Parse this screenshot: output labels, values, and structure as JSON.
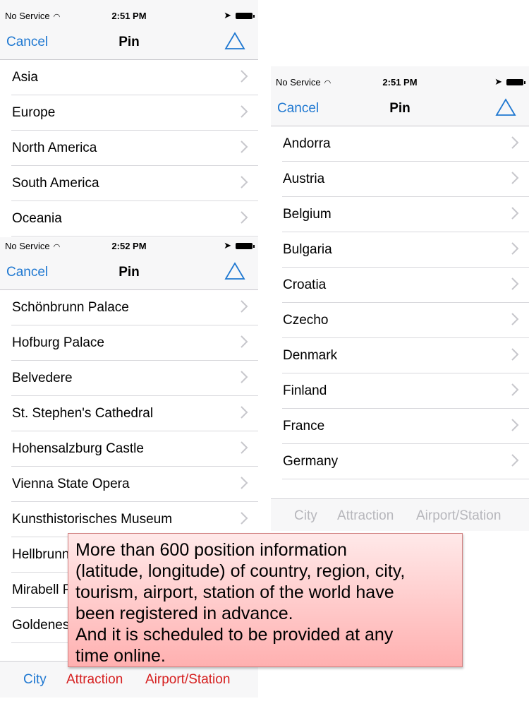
{
  "colors": {
    "accent": "#1f78d1",
    "red": "#d62020",
    "gray": "#b7b7bc"
  },
  "screens": {
    "top_left": {
      "status": {
        "carrier": "No Service",
        "time": "2:51 PM"
      },
      "nav": {
        "cancel": "Cancel",
        "title": "Pin",
        "share_icon": "share-triangle-icon"
      },
      "rows": [
        "Asia",
        "Europe",
        "North America",
        "South America",
        "Oceania"
      ]
    },
    "right": {
      "status": {
        "carrier": "No Service",
        "time": "2:51 PM"
      },
      "nav": {
        "cancel": "Cancel",
        "title": "Pin",
        "share_icon": "share-triangle-icon"
      },
      "rows": [
        "Andorra",
        "Austria",
        "Belgium",
        "Bulgaria",
        "Croatia",
        "Czecho",
        "Denmark",
        "Finland",
        "France",
        "Germany"
      ],
      "tabs": [
        "City",
        "Attraction",
        "Airport/Station"
      ]
    },
    "bottom_left": {
      "status": {
        "carrier": "No Service",
        "time": "2:52 PM"
      },
      "nav": {
        "cancel": "Cancel",
        "title": "Pin",
        "share_icon": "share-triangle-icon"
      },
      "rows": [
        "Schönbrunn Palace",
        "Hofburg Palace",
        "Belvedere",
        "St. Stephen's Cathedral",
        "Hohensalzburg Castle",
        "Vienna State Opera",
        "Kunsthistorisches Museum",
        "Hellbrunn",
        "Mirabell P",
        "Goldenes"
      ],
      "tabs": [
        "City",
        "Attraction",
        "Airport/Station"
      ]
    }
  },
  "callout": {
    "lines": [
      "More than 600 position information",
      "(latitude, longitude) of country, region, city,",
      "tourism, airport, station of the world have",
      "been registered in advance.",
      "And it is scheduled to be provided at any",
      "time online."
    ]
  }
}
